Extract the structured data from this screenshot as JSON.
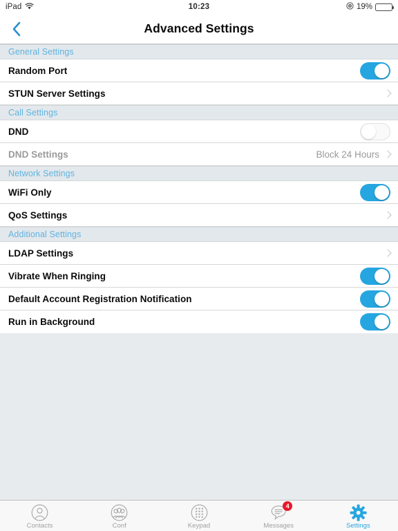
{
  "statusbar": {
    "device": "iPad",
    "wifi_icon": "wifi-icon",
    "time": "10:23",
    "orientation_lock_icon": "rotation-lock-icon",
    "battery_percent": "19%",
    "battery_level": 19,
    "battery_icon": "battery-icon"
  },
  "navbar": {
    "back_icon": "back-chevron-icon",
    "title": "Advanced Settings"
  },
  "colors": {
    "accent": "#26a6e0",
    "section_header_text": "#5fb3e0",
    "disabled_text": "#9a9a9a",
    "badge": "#e8172a",
    "page_background": "#e7ebee"
  },
  "sections": [
    {
      "header": "General Settings",
      "rows": [
        {
          "label": "Random Port",
          "type": "switch",
          "state": "on",
          "disabled": false
        },
        {
          "label": "STUN Server Settings",
          "type": "disclosure",
          "value": "",
          "disabled": false
        }
      ]
    },
    {
      "header": "Call Settings",
      "rows": [
        {
          "label": "DND",
          "type": "switch",
          "state": "off",
          "disabled": false
        },
        {
          "label": "DND Settings",
          "type": "disclosure",
          "value": "Block 24 Hours",
          "disabled": true
        }
      ]
    },
    {
      "header": "Network Settings",
      "rows": [
        {
          "label": "WiFi Only",
          "type": "switch",
          "state": "on",
          "disabled": false
        },
        {
          "label": "QoS Settings",
          "type": "disclosure",
          "value": "",
          "disabled": false
        }
      ]
    },
    {
      "header": "Additional Settings",
      "rows": [
        {
          "label": "LDAP Settings",
          "type": "disclosure",
          "value": "",
          "disabled": false
        },
        {
          "label": "Vibrate When Ringing",
          "type": "switch",
          "state": "on",
          "disabled": false
        },
        {
          "label": "Default Account Registration Notification",
          "type": "switch",
          "state": "on",
          "disabled": false
        },
        {
          "label": "Run in Background",
          "type": "switch",
          "state": "on",
          "disabled": false
        }
      ]
    }
  ],
  "tabbar": {
    "tabs": [
      {
        "label": "Contacts",
        "icon": "contacts-icon",
        "active": false,
        "badge": ""
      },
      {
        "label": "Conf",
        "icon": "conference-icon",
        "active": false,
        "badge": ""
      },
      {
        "label": "Keypad",
        "icon": "keypad-icon",
        "active": false,
        "badge": ""
      },
      {
        "label": "Messages",
        "icon": "messages-icon",
        "active": false,
        "badge": "4"
      },
      {
        "label": "Settings",
        "icon": "gear-icon",
        "active": true,
        "badge": ""
      }
    ]
  }
}
